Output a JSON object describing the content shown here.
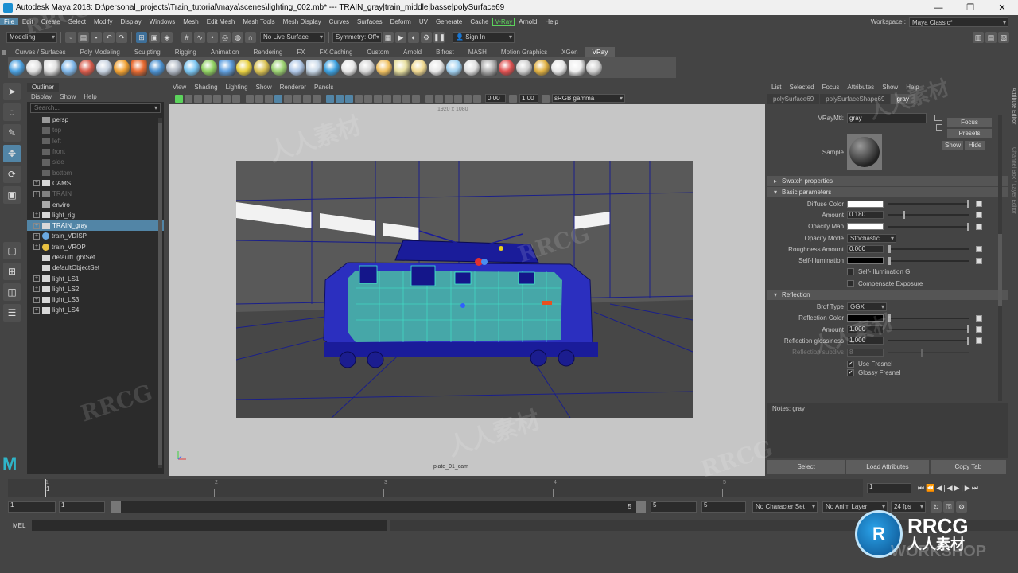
{
  "window": {
    "title": "Autodesk Maya 2018: D:\\personal_projects\\Train_tutorial\\maya\\scenes\\lighting_002.mb*   ---   TRAIN_gray|train_middle|basse|polySurface69",
    "min": "—",
    "max": "❐",
    "close": "✕"
  },
  "menubar": {
    "items": [
      "File",
      "Edit",
      "Create",
      "Select",
      "Modify",
      "Display",
      "Windows",
      "Mesh",
      "Edit Mesh",
      "Mesh Tools",
      "Mesh Display",
      "Curves",
      "Surfaces",
      "Deform",
      "UV",
      "Generate",
      "Cache",
      "V-Ray",
      "Arnold",
      "Help"
    ],
    "workspace_label": "Workspace :",
    "workspace_value": "Maya Classic*"
  },
  "statusline": {
    "menuset": "Modeling",
    "live_surface": "No Live Surface",
    "symmetry": "Symmetry: Off",
    "sign_in": "Sign In"
  },
  "shelf": {
    "tabs": [
      "Curves / Surfaces",
      "Poly Modeling",
      "Sculpting",
      "Rigging",
      "Animation",
      "Rendering",
      "FX",
      "FX Caching",
      "Custom",
      "Arnold",
      "Bifrost",
      "MASH",
      "Motion Graphics",
      "XGen",
      "VRay"
    ],
    "active": "VRay",
    "icon_colors": [
      "#4aa0e0",
      "#e0e0e0",
      "#e0e0e0",
      "#7fb6e8",
      "#d85a4a",
      "#c7d2e0",
      "#f0a030",
      "#e86a30",
      "#4a90d0",
      "#b0b8c4",
      "#78c4f0",
      "#8fd060",
      "#60a0e0",
      "#e8d040",
      "#d8c050",
      "#9ad070",
      "#b0c8e8",
      "#c8d8e8",
      "#3aa0e0",
      "#e8e8e8",
      "#d8d8d8",
      "#f0c060",
      "#e8e0a0",
      "#f0d890",
      "#e8e8e8",
      "#a0d0f0",
      "#e0e0e0",
      "#b0b0b0",
      "#e05050",
      "#d0d0d0",
      "#e0b040",
      "#e8e8e8",
      "#f0f0f0",
      "#d0d0d0"
    ]
  },
  "outliner": {
    "title": "Outliner",
    "menu": [
      "Display",
      "Show",
      "Help"
    ],
    "search_placeholder": "Search...",
    "items": [
      {
        "label": "persp",
        "dim": false,
        "exp": false,
        "icon": "camera"
      },
      {
        "label": "top",
        "dim": true,
        "exp": false,
        "icon": "camera"
      },
      {
        "label": "left",
        "dim": true,
        "exp": false,
        "icon": "camera"
      },
      {
        "label": "front",
        "dim": true,
        "exp": false,
        "icon": "camera"
      },
      {
        "label": "side",
        "dim": true,
        "exp": false,
        "icon": "camera"
      },
      {
        "label": "bottom",
        "dim": true,
        "exp": false,
        "icon": "camera"
      },
      {
        "label": "CAMS",
        "dim": false,
        "exp": true,
        "icon": "group"
      },
      {
        "label": "TRAIN",
        "dim": true,
        "exp": true,
        "icon": "group"
      },
      {
        "label": "enviro",
        "dim": false,
        "exp": false,
        "icon": "mesh"
      },
      {
        "label": "light_rig",
        "dim": false,
        "exp": true,
        "icon": "group"
      },
      {
        "label": "TRAIN_gray",
        "dim": false,
        "exp": true,
        "icon": "group",
        "selected": true
      },
      {
        "label": "train_VDISP",
        "dim": false,
        "exp": true,
        "icon": "sphere"
      },
      {
        "label": "train_VROP",
        "dim": false,
        "exp": true,
        "icon": "sun"
      },
      {
        "label": "defaultLightSet",
        "dim": false,
        "exp": false,
        "icon": "set"
      },
      {
        "label": "defaultObjectSet",
        "dim": false,
        "exp": false,
        "icon": "set"
      },
      {
        "label": "light_LS1",
        "dim": false,
        "exp": true,
        "icon": "group"
      },
      {
        "label": "light_LS2",
        "dim": false,
        "exp": true,
        "icon": "group"
      },
      {
        "label": "light_LS3",
        "dim": false,
        "exp": true,
        "icon": "group"
      },
      {
        "label": "light_LS4",
        "dim": false,
        "exp": true,
        "icon": "group"
      }
    ]
  },
  "viewport": {
    "menu": [
      "View",
      "Shading",
      "Lighting",
      "Show",
      "Renderer",
      "Panels"
    ],
    "exposure": "0.00",
    "gamma": "1.00",
    "colorspace": "sRGB gamma",
    "resolution": "1920 x 1080",
    "camera": "plate_01_cam"
  },
  "attribute_editor": {
    "menu": [
      "List",
      "Selected",
      "Focus",
      "Attributes",
      "Show",
      "Help"
    ],
    "tabs": [
      "polySurface69",
      "polySurfaceShape69",
      "gray"
    ],
    "active_tab": "gray",
    "material_label": "VRayMtl:",
    "material_name": "gray",
    "sample_label": "Sample",
    "buttons": {
      "focus": "Focus",
      "presets": "Presets",
      "show": "Show",
      "hide": "Hide"
    },
    "sections": {
      "swatch": "Swatch properties",
      "basic": "Basic parameters",
      "reflection": "Reflection"
    },
    "basic": {
      "diffuse_color": "Diffuse Color",
      "amount": "Amount",
      "amount_value": "0.180",
      "opacity_map": "Opacity Map",
      "opacity_mode": "Opacity Mode",
      "opacity_mode_value": "Stochastic",
      "roughness": "Roughness Amount",
      "roughness_value": "0.000",
      "self_illum": "Self-Illumination",
      "self_illum_gi": "Self-Illumination GI",
      "comp_exposure": "Compensate Exposure"
    },
    "reflection": {
      "brdf_type": "Brdf Type",
      "brdf_value": "GGX",
      "refl_color": "Reflection Color",
      "amount": "Amount",
      "amount_value": "1.000",
      "glossiness": "Reflection glossiness",
      "glossiness_value": "1.000",
      "subdivs": "Reflection subdivs",
      "subdivs_value": "8",
      "use_fresnel": "Use Fresnel",
      "glossy_fresnel": "Glossy Fresnel"
    },
    "notes": "Notes: gray",
    "bottom": [
      "Select",
      "Load Attributes",
      "Copy Tab"
    ],
    "side_tabs": [
      "Attribute Editor",
      "Channel Box / Layer Editor"
    ]
  },
  "timeline": {
    "ticks": [
      "1",
      "2",
      "3",
      "4",
      "5"
    ],
    "current": "1",
    "current_frame_field": "1",
    "start": "1",
    "start2": "1",
    "end": "5",
    "end2": "5",
    "end3": "5",
    "character_set": "No Character Set",
    "anim_layer": "No Anim Layer",
    "fps": "24 fps"
  },
  "cmdline": {
    "label": "MEL"
  },
  "watermarks": [
    "RRCG",
    "人人素材",
    "RRCG",
    "人人素材",
    "RRCG",
    "人人素材",
    "RRCG",
    "人人素材"
  ],
  "badge": {
    "brand": "RRCG",
    "sub": "人人素材",
    "workshop": "WORKSHOP"
  }
}
